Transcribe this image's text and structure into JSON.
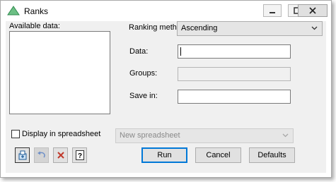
{
  "window": {
    "title": "Ranks"
  },
  "titlebar": {
    "minimize_icon": "minimize-icon",
    "maximize_icon": "maximize-icon",
    "close_icon": "close-icon"
  },
  "available": {
    "label": "Available data:"
  },
  "ranking": {
    "label": "Ranking method:",
    "value": "Ascending"
  },
  "fields": {
    "data_label": "Data:",
    "data_value": "",
    "groups_label": "Groups:",
    "groups_value": "",
    "save_label": "Save in:",
    "save_value": ""
  },
  "spreadsheet": {
    "checkbox_label": "Display in spreadsheet",
    "checked": false,
    "select_value": "New spreadsheet"
  },
  "buttons": {
    "run": "Run",
    "cancel": "Cancel",
    "defaults": "Defaults"
  },
  "icons": {
    "options": "options-icon",
    "undo": "undo-icon",
    "clear": "clear-icon",
    "help": "help-icon"
  },
  "colors": {
    "accent": "#0078d7",
    "title_icon": "#3a9a5a",
    "clear_icon": "#c0392b"
  }
}
